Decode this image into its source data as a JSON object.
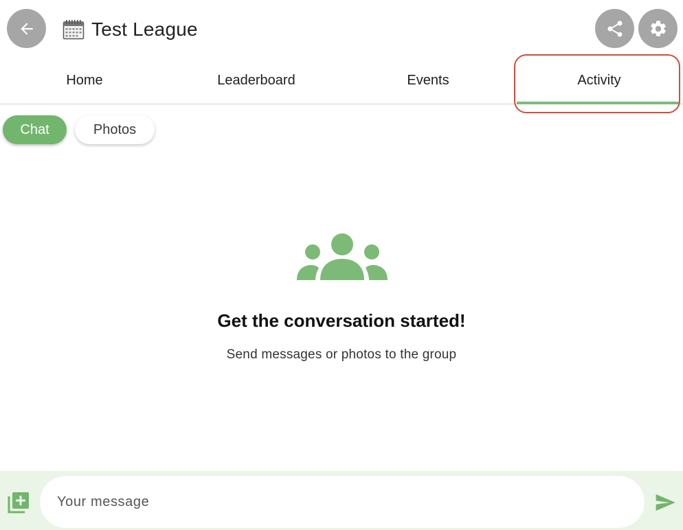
{
  "header": {
    "title": "Test League",
    "icons": {
      "back": "arrow-left-icon",
      "calendar": "calendar-icon",
      "share": "share-icon",
      "settings": "gear-icon"
    }
  },
  "tabs": [
    {
      "label": "Home"
    },
    {
      "label": "Leaderboard"
    },
    {
      "label": "Events"
    },
    {
      "label": "Activity",
      "selected": true
    }
  ],
  "chips": {
    "chat": "Chat",
    "photos": "Photos",
    "selected": "Chat"
  },
  "empty_state": {
    "icon": "group-icon",
    "title": "Get the conversation started!",
    "subtitle": "Send messages or photos to the group"
  },
  "composer": {
    "placeholder": "Your message",
    "add_photo_icon": "add-photo-icon",
    "send_icon": "send-icon"
  },
  "colors": {
    "accent": "#72b56c",
    "tab_indicator": "#7dba78",
    "highlight": "#d24c3a",
    "icon_button_bg": "#a6a6a6",
    "composer_bg": "#eaf4e7"
  }
}
